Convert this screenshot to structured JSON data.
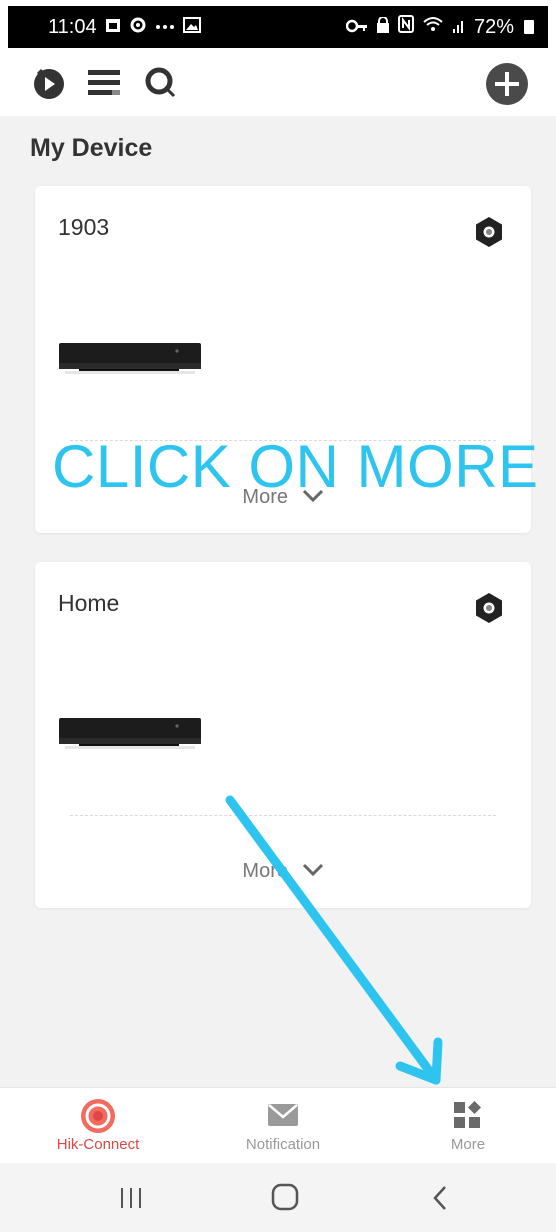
{
  "status_bar": {
    "time": "11:04",
    "left_icons": [
      "calendar-icon",
      "settings-icon",
      "dots-icon",
      "image-icon"
    ],
    "right_icons": [
      "key-icon",
      "lock-icon",
      "nfc-icon",
      "wifi-icon",
      "signal-icon"
    ],
    "battery": "72%"
  },
  "header": {
    "icons": [
      "playback-icon",
      "list-icon",
      "search-icon",
      "add-icon"
    ]
  },
  "page_title": "My Device",
  "devices": [
    {
      "name": "1903",
      "more_label": "More"
    },
    {
      "name": "Home",
      "more_label": "More"
    }
  ],
  "overlay": {
    "instruction": "CLICK ON MORE",
    "color": "#2ec4f0"
  },
  "bottom_nav": [
    {
      "label": "Hik-Connect",
      "icon": "hik-connect-icon",
      "active": true
    },
    {
      "label": "Notification",
      "icon": "envelope-icon",
      "active": false
    },
    {
      "label": "More",
      "icon": "grid-icon",
      "active": false
    }
  ],
  "system_nav": [
    "recents-icon",
    "home-icon",
    "back-icon"
  ],
  "colors": {
    "accent": "#e14646",
    "overlay": "#2ec4f0",
    "background": "#f2f2f2"
  }
}
